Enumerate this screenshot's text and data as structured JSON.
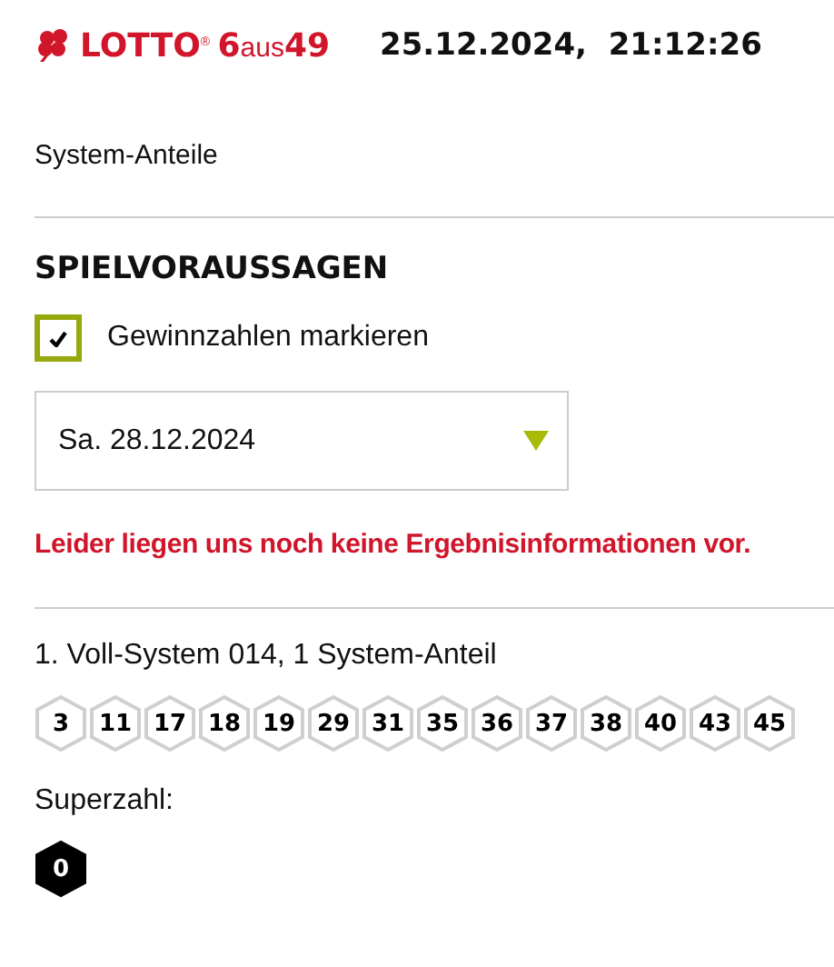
{
  "header": {
    "logo": "**LOTTO**$^{®}$ **6**aus**49**",
    "datetime": "25.12.2024,  21:12:26"
  },
  "section_title": "System-Anteile",
  "predictions": {
    "heading": "SPIELVORAUSSAGEN",
    "checkbox": {
      "label": "Gewinnzahlen markieren",
      "checked": true
    },
    "date_select": {
      "value": "Sa. 28.12.2024"
    },
    "message": "Leider liegen uns noch keine Ergebnisinformationen vor."
  },
  "system": {
    "title": "1. Voll-System 014, 1 System-Anteil",
    "numbers": [
      "3",
      "11",
      "17",
      "18",
      "19",
      "29",
      "31",
      "35",
      "36",
      "37",
      "38",
      "40",
      "43",
      "45"
    ],
    "superzahl_label": "Superzahl:",
    "superzahl": "0"
  }
}
